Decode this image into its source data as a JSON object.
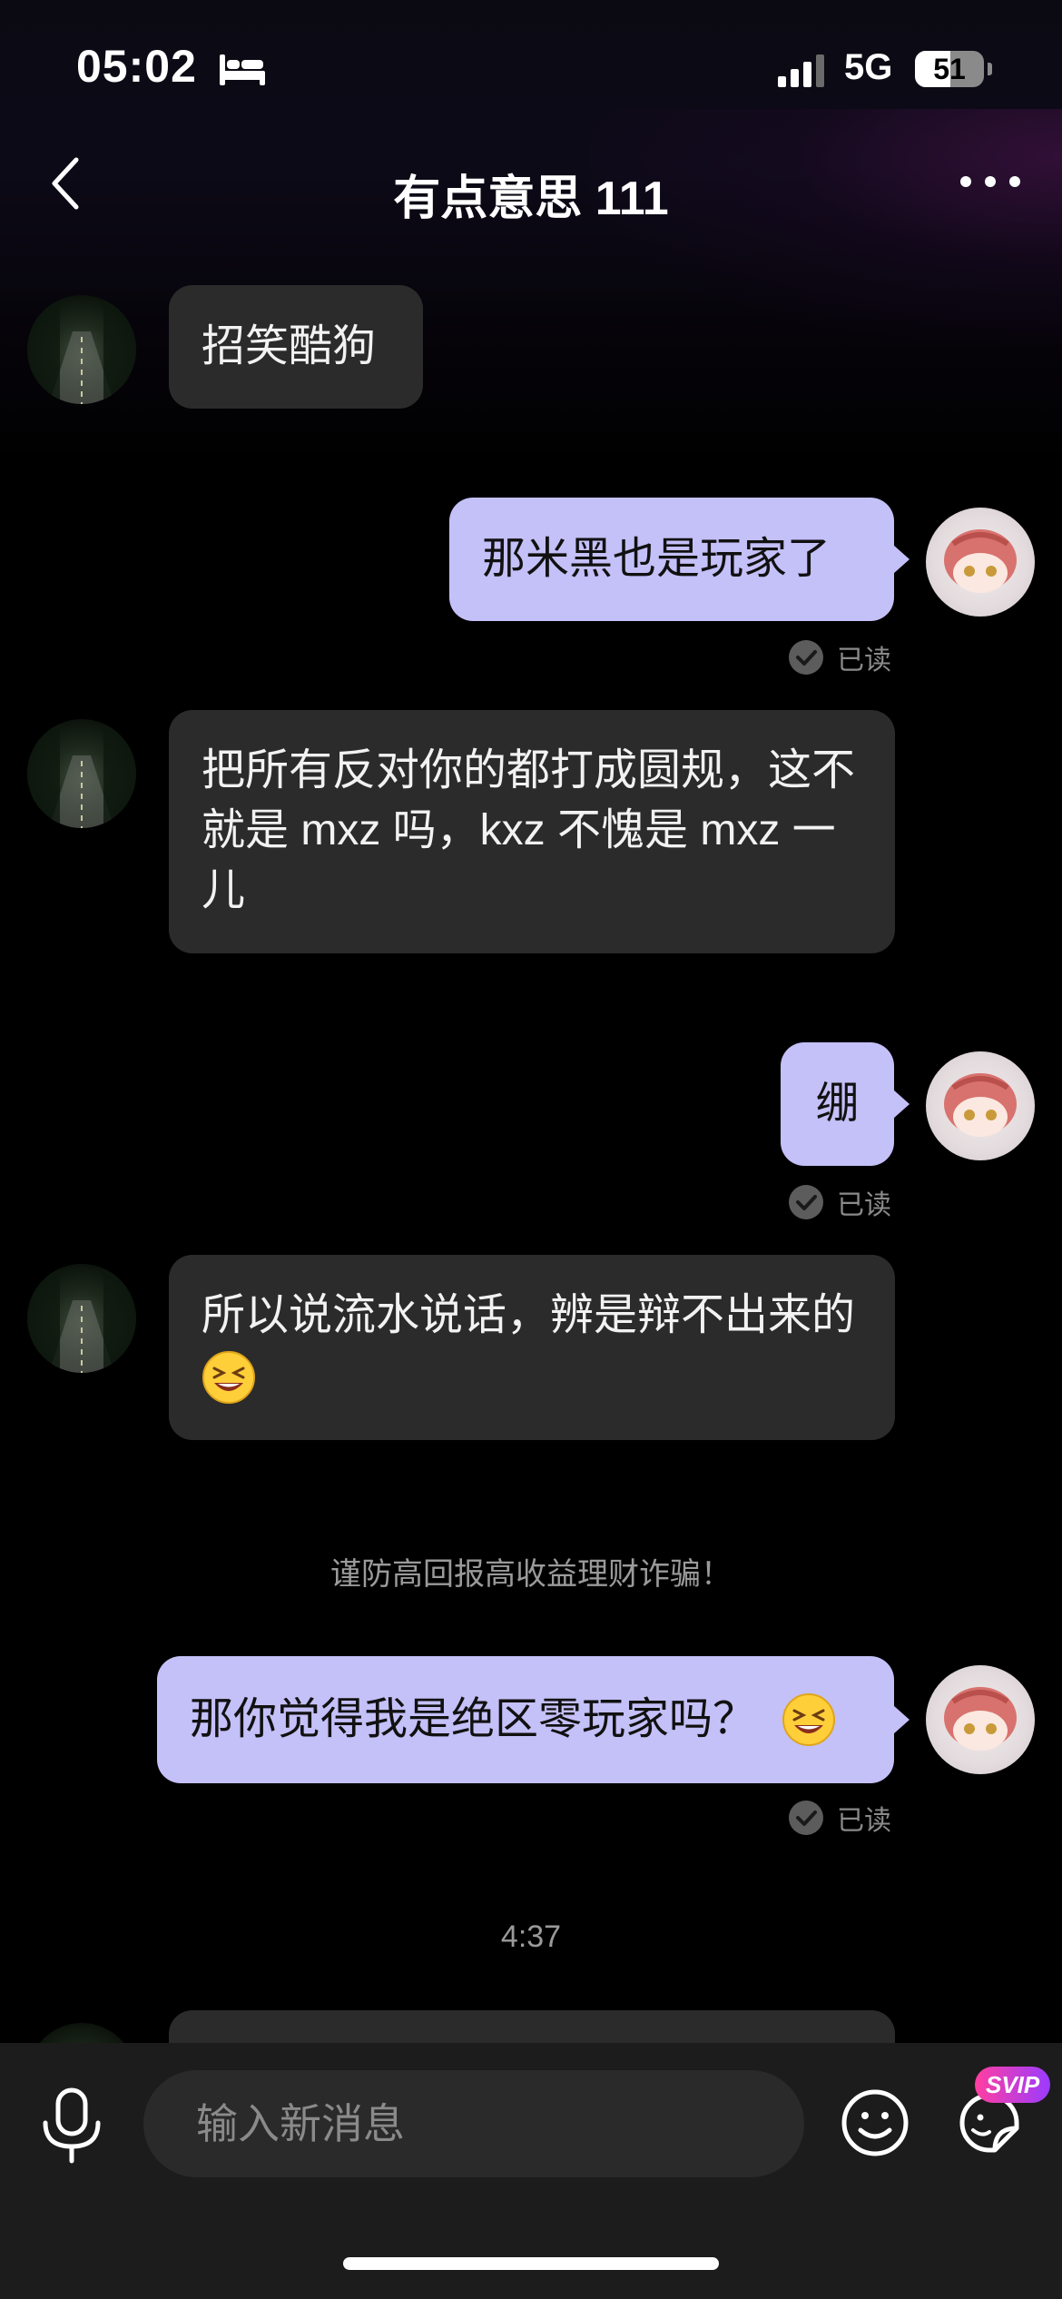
{
  "status_bar": {
    "time": "05:02",
    "network": "5G",
    "battery_level": "51",
    "icons": [
      "sleep-bed-icon",
      "signal-bars-icon",
      "battery-icon"
    ]
  },
  "header": {
    "title": "有点意思 111",
    "icons": [
      "chevron-left-icon",
      "more-dots-icon"
    ]
  },
  "messages": [
    {
      "sender": "other",
      "text": "招笑酷狗"
    },
    {
      "sender": "me",
      "text": "那米黑也是玩家了",
      "status": "已读"
    },
    {
      "sender": "other",
      "text": "把所有反对你的都打成圆规，这不就是 mxz 吗，kxz 不愧是 mxz 一儿"
    },
    {
      "sender": "me",
      "text": "绷",
      "status": "已读"
    },
    {
      "sender": "other",
      "text": "所以说流水说话，辨是辩不出来的",
      "emoji": "grinning-squint-emoji"
    },
    {
      "sender": "me",
      "text": "那你觉得我是绝区零玩家吗？",
      "emoji": "grinning-squint-emoji",
      "status": "已读"
    }
  ],
  "system_notice": "谨防高回报高收益理财诈骗！",
  "time_divider": "4:37",
  "input_bar": {
    "placeholder": "输入新消息",
    "badge": "SVIP",
    "icons": [
      "microphone-icon",
      "smiley-icon",
      "sticker-icon"
    ]
  },
  "colors": {
    "outgoing_bubble": "#c4c0f8",
    "incoming_bubble": "#2b2b2b",
    "background": "#000000",
    "input_bar": "#1c1c1c"
  }
}
